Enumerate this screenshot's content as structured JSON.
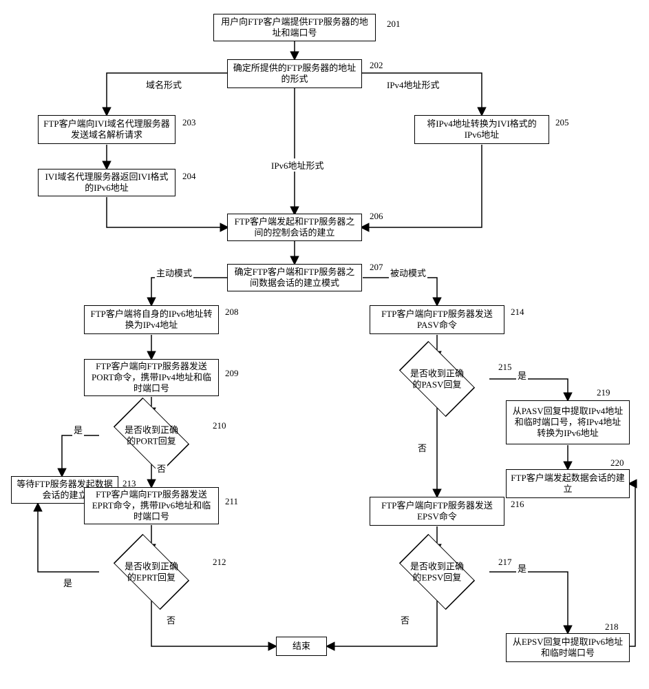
{
  "nodes": {
    "n201": "用户向FTP客户端提供FTP服务器的地址和端口号",
    "n202": "确定所提供的FTP服务器的地址的形式",
    "n203": "FTP客户端向IVI域名代理服务器发送域名解析请求",
    "n204": "IVI域名代理服务器返回IVI格式的IPv6地址",
    "n205": "将IPv4地址转换为IVI格式的IPv6地址",
    "n206": "FTP客户端发起和FTP服务器之间的控制会话的建立",
    "n207": "确定FTP客户端和FTP服务器之间数据会话的建立模式",
    "n208": "FTP客户端将自身的IPv6地址转换为IPv4地址",
    "n209": "FTP客户端向FTP服务器发送PORT命令，携带IPv4地址和临时端口号",
    "n210": "是否收到正确的PORT回复",
    "n211": "FTP客户端向FTP服务器发送EPRT命令，携带IPv6地址和临时端口号",
    "n212": "是否收到正确的EPRT回复",
    "n213": "等待FTP服务器发起数据会话的建立",
    "n214": "FTP客户端向FTP服务器发送PASV命令",
    "n215": "是否收到正确的PASV回复",
    "n216": "FTP客户端向FTP服务器发送EPSV命令",
    "n217": "是否收到正确的EPSV回复",
    "n218": "从EPSV回复中提取IPv6地址和临时端口号",
    "n219": "从PASV回复中提取IPv4地址和临时端口号，将IPv4地址转换为IPv6地址",
    "n220": "FTP客户端发起数据会话的建立",
    "end": "结束"
  },
  "labels": {
    "l201": "201",
    "l202": "202",
    "l203": "203",
    "l204": "204",
    "l205": "205",
    "l206": "206",
    "l207": "207",
    "l208": "208",
    "l209": "209",
    "l210": "210",
    "l211": "211",
    "l212": "212",
    "l213": "213",
    "l214": "214",
    "l215": "215",
    "l216": "216",
    "l217": "217",
    "l218": "218",
    "l219": "219",
    "l220": "220"
  },
  "edges": {
    "e_domain": "域名形式",
    "e_ipv6": "IPv6地址形式",
    "e_ipv4": "IPv4地址形式",
    "e_active": "主动模式",
    "e_passive": "被动模式",
    "yes": "是",
    "no": "否"
  }
}
